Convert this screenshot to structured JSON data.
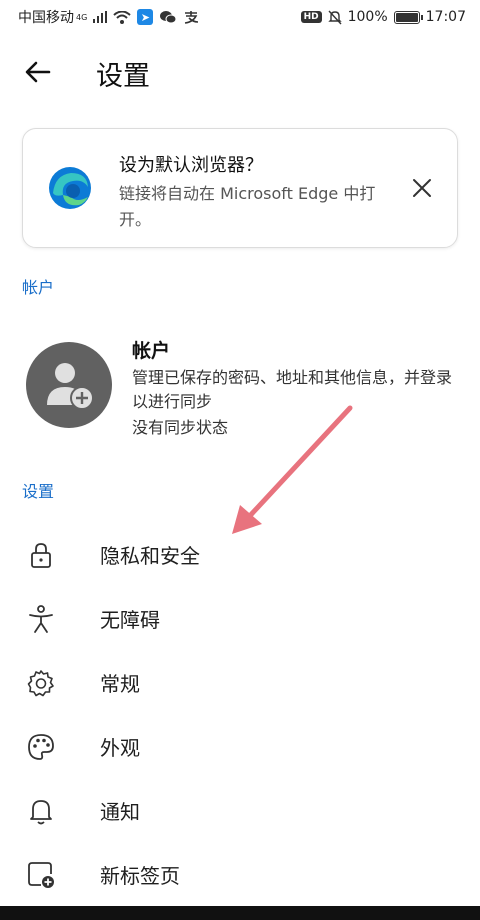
{
  "status_bar": {
    "carrier": "中国移动",
    "network": "4G",
    "battery_percent": "100%",
    "battery_level": 1.0,
    "time": "17:07",
    "hd_label": "HD"
  },
  "header": {
    "title": "设置",
    "back_icon": "arrow-left-icon"
  },
  "default_browser_banner": {
    "title": "设为默认浏览器？",
    "description": "链接将自动在 Microsoft Edge 中打开。",
    "logo_icon": "edge-logo",
    "close_icon": "close-icon"
  },
  "account_section": {
    "label": "帐户",
    "title": "帐户",
    "description": "管理已保存的密码、地址和其他信息，并登录以进行同步",
    "sync_status": "没有同步状态"
  },
  "settings_section": {
    "label": "设置",
    "items": [
      {
        "label": "隐私和安全",
        "icon": "lock-icon"
      },
      {
        "label": "无障碍",
        "icon": "accessibility-icon"
      },
      {
        "label": "常规",
        "icon": "gear-icon"
      },
      {
        "label": "外观",
        "icon": "palette-icon"
      },
      {
        "label": "通知",
        "icon": "bell-icon"
      },
      {
        "label": "新标签页",
        "icon": "new-tab-icon"
      }
    ]
  },
  "colors": {
    "accent": "#1a6ec9",
    "annotation_arrow": "#e8737e"
  }
}
